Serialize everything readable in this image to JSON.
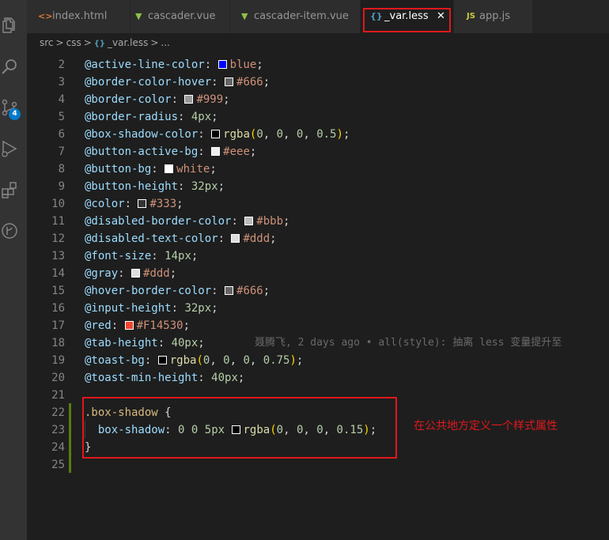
{
  "activity_bar": {
    "icons": [
      "explorer-icon",
      "search-icon",
      "source-control-icon",
      "debug-icon",
      "extensions-icon",
      "git-graph-icon"
    ],
    "scm_badge": "4"
  },
  "tabs": [
    {
      "label": "index.html",
      "icon": "html-file-icon",
      "glyph": "<>",
      "color": "#e37933",
      "active": false
    },
    {
      "label": "cascader.vue",
      "icon": "vue-file-icon",
      "glyph": "▼",
      "color": "#8dc149",
      "active": false
    },
    {
      "label": "cascader-item.vue",
      "icon": "vue-file-icon",
      "glyph": "▼",
      "color": "#8dc149",
      "active": false
    },
    {
      "label": "_var.less",
      "icon": "less-file-icon",
      "glyph": "{}",
      "color": "#519aba",
      "active": true,
      "close": "✕"
    },
    {
      "label": "app.js",
      "icon": "js-file-icon",
      "glyph": "JS",
      "color": "#cbcb41",
      "active": false
    }
  ],
  "breadcrumb": {
    "parts": [
      "src",
      "css",
      "_var.less",
      "..."
    ],
    "sep": ">",
    "file_glyph": "{}"
  },
  "code_lines": [
    {
      "ln": "2",
      "tokens": [
        [
          "k",
          "@active-line-color"
        ],
        [
          "p",
          ": "
        ],
        [
          "sw",
          "#0000ff"
        ],
        [
          "str",
          "blue"
        ],
        [
          "p",
          ";"
        ]
      ]
    },
    {
      "ln": "3",
      "tokens": [
        [
          "k",
          "@border-color-hover"
        ],
        [
          "p",
          ": "
        ],
        [
          "sw",
          "#666666"
        ],
        [
          "str",
          "#666"
        ],
        [
          "p",
          ";"
        ]
      ]
    },
    {
      "ln": "4",
      "tokens": [
        [
          "k",
          "@border-color"
        ],
        [
          "p",
          ": "
        ],
        [
          "sw",
          "#999999"
        ],
        [
          "str",
          "#999"
        ],
        [
          "p",
          ";"
        ]
      ]
    },
    {
      "ln": "5",
      "tokens": [
        [
          "k",
          "@border-radius"
        ],
        [
          "p",
          ": "
        ],
        [
          "num",
          "4px"
        ],
        [
          "p",
          ";"
        ]
      ]
    },
    {
      "ln": "6",
      "tokens": [
        [
          "k",
          "@box-shadow-color"
        ],
        [
          "p",
          ": "
        ],
        [
          "sw",
          "#000000"
        ],
        [
          "fn",
          "rgba"
        ],
        [
          "brace",
          "("
        ],
        [
          "num",
          "0"
        ],
        [
          "p",
          ", "
        ],
        [
          "num",
          "0"
        ],
        [
          "p",
          ", "
        ],
        [
          "num",
          "0"
        ],
        [
          "p",
          ", "
        ],
        [
          "num",
          "0.5"
        ],
        [
          "brace",
          ")"
        ],
        [
          "p",
          ";"
        ]
      ]
    },
    {
      "ln": "7",
      "tokens": [
        [
          "k",
          "@button-active-bg"
        ],
        [
          "p",
          ": "
        ],
        [
          "sw",
          "#eeeeee"
        ],
        [
          "str",
          "#eee"
        ],
        [
          "p",
          ";"
        ]
      ]
    },
    {
      "ln": "8",
      "tokens": [
        [
          "k",
          "@button-bg"
        ],
        [
          "p",
          ": "
        ],
        [
          "sw",
          "#ffffff"
        ],
        [
          "str",
          "white"
        ],
        [
          "p",
          ";"
        ]
      ]
    },
    {
      "ln": "9",
      "tokens": [
        [
          "k",
          "@button-height"
        ],
        [
          "p",
          ": "
        ],
        [
          "num",
          "32px"
        ],
        [
          "p",
          ";"
        ]
      ]
    },
    {
      "ln": "10",
      "tokens": [
        [
          "k",
          "@color"
        ],
        [
          "p",
          ": "
        ],
        [
          "sw",
          "#333333"
        ],
        [
          "str",
          "#333"
        ],
        [
          "p",
          ";"
        ]
      ]
    },
    {
      "ln": "11",
      "tokens": [
        [
          "k",
          "@disabled-border-color"
        ],
        [
          "p",
          ": "
        ],
        [
          "sw",
          "#bbbbbb"
        ],
        [
          "str",
          "#bbb"
        ],
        [
          "p",
          ";"
        ]
      ]
    },
    {
      "ln": "12",
      "tokens": [
        [
          "k",
          "@disabled-text-color"
        ],
        [
          "p",
          ": "
        ],
        [
          "sw",
          "#dddddd"
        ],
        [
          "str",
          "#ddd"
        ],
        [
          "p",
          ";"
        ]
      ]
    },
    {
      "ln": "13",
      "tokens": [
        [
          "k",
          "@font-size"
        ],
        [
          "p",
          ": "
        ],
        [
          "num",
          "14px"
        ],
        [
          "p",
          ";"
        ]
      ]
    },
    {
      "ln": "14",
      "tokens": [
        [
          "k",
          "@gray"
        ],
        [
          "p",
          ": "
        ],
        [
          "sw",
          "#dddddd"
        ],
        [
          "str",
          "#ddd"
        ],
        [
          "p",
          ";"
        ]
      ]
    },
    {
      "ln": "15",
      "tokens": [
        [
          "k",
          "@hover-border-color"
        ],
        [
          "p",
          ": "
        ],
        [
          "sw",
          "#666666"
        ],
        [
          "str",
          "#666"
        ],
        [
          "p",
          ";"
        ]
      ]
    },
    {
      "ln": "16",
      "tokens": [
        [
          "k",
          "@input-height"
        ],
        [
          "p",
          ": "
        ],
        [
          "num",
          "32px"
        ],
        [
          "p",
          ";"
        ]
      ]
    },
    {
      "ln": "17",
      "tokens": [
        [
          "k",
          "@red"
        ],
        [
          "p",
          ": "
        ],
        [
          "sw",
          "#F14530"
        ],
        [
          "str",
          "#F14530"
        ],
        [
          "p",
          ";"
        ]
      ]
    },
    {
      "ln": "18",
      "tokens": [
        [
          "k",
          "@tab-height"
        ],
        [
          "p",
          ": "
        ],
        [
          "num",
          "40px"
        ],
        [
          "p",
          ";"
        ]
      ],
      "blame": "聂腾飞, 2 days ago • all(style): 抽离 less 变量提升至"
    },
    {
      "ln": "19",
      "tokens": [
        [
          "k",
          "@toast-bg"
        ],
        [
          "p",
          ": "
        ],
        [
          "sw",
          "#000000"
        ],
        [
          "fn",
          "rgba"
        ],
        [
          "brace",
          "("
        ],
        [
          "num",
          "0"
        ],
        [
          "p",
          ", "
        ],
        [
          "num",
          "0"
        ],
        [
          "p",
          ", "
        ],
        [
          "num",
          "0"
        ],
        [
          "p",
          ", "
        ],
        [
          "num",
          "0.75"
        ],
        [
          "brace",
          ")"
        ],
        [
          "p",
          ";"
        ]
      ]
    },
    {
      "ln": "20",
      "tokens": [
        [
          "k",
          "@toast-min-height"
        ],
        [
          "p",
          ": "
        ],
        [
          "num",
          "40px"
        ],
        [
          "p",
          ";"
        ]
      ]
    },
    {
      "ln": "21",
      "tokens": []
    },
    {
      "ln": "22",
      "tokens": [
        [
          "sel",
          ".box-shadow"
        ],
        [
          "p",
          " "
        ],
        [
          "p",
          "{"
        ]
      ]
    },
    {
      "ln": "23",
      "tokens": [
        [
          "p",
          "  "
        ],
        [
          "k",
          "box-shadow"
        ],
        [
          "p",
          ": "
        ],
        [
          "num",
          "0"
        ],
        [
          "p",
          " "
        ],
        [
          "num",
          "0"
        ],
        [
          "p",
          " "
        ],
        [
          "num",
          "5px"
        ],
        [
          "p",
          " "
        ],
        [
          "sw",
          "#000000"
        ],
        [
          "fn",
          "rgba"
        ],
        [
          "brace",
          "("
        ],
        [
          "num",
          "0"
        ],
        [
          "p",
          ", "
        ],
        [
          "num",
          "0"
        ],
        [
          "p",
          ", "
        ],
        [
          "num",
          "0"
        ],
        [
          "p",
          ", "
        ],
        [
          "num",
          "0.15"
        ],
        [
          "brace",
          ")"
        ],
        [
          "p",
          ";"
        ]
      ]
    },
    {
      "ln": "24",
      "tokens": [
        [
          "p",
          "}"
        ]
      ]
    },
    {
      "ln": "25",
      "tokens": []
    }
  ],
  "annotation": "在公共地方定义一个样式属性"
}
